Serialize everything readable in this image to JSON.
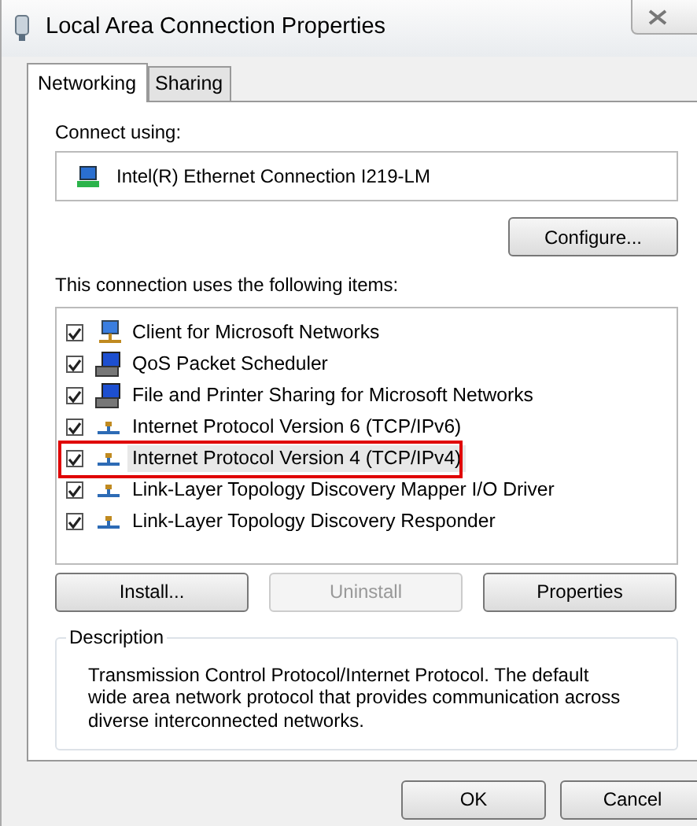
{
  "window": {
    "title": "Local Area Connection Properties"
  },
  "tabs": [
    {
      "label": "Networking",
      "selected": true
    },
    {
      "label": "Sharing",
      "selected": false
    }
  ],
  "connect_using": {
    "label": "Connect using:",
    "adapter": "Intel(R) Ethernet Connection I219-LM",
    "configure_button": "Configure..."
  },
  "items_label": "This connection uses the following items:",
  "items": [
    {
      "kind": "client",
      "label": "Client for Microsoft Networks",
      "checked": true,
      "selected": false,
      "highlighted": false
    },
    {
      "kind": "service",
      "label": "QoS Packet Scheduler",
      "checked": true,
      "selected": false,
      "highlighted": false
    },
    {
      "kind": "service",
      "label": "File and Printer Sharing for Microsoft Networks",
      "checked": true,
      "selected": false,
      "highlighted": false
    },
    {
      "kind": "protocol",
      "label": "Internet Protocol Version 6 (TCP/IPv6)",
      "checked": true,
      "selected": false,
      "highlighted": false
    },
    {
      "kind": "protocol",
      "label": "Internet Protocol Version 4 (TCP/IPv4)",
      "checked": true,
      "selected": true,
      "highlighted": true
    },
    {
      "kind": "protocol",
      "label": "Link-Layer Topology Discovery Mapper I/O Driver",
      "checked": true,
      "selected": false,
      "highlighted": false
    },
    {
      "kind": "protocol",
      "label": "Link-Layer Topology Discovery Responder",
      "checked": true,
      "selected": false,
      "highlighted": false
    }
  ],
  "item_buttons": [
    {
      "label": "Install...",
      "disabled": false
    },
    {
      "label": "Uninstall",
      "disabled": true
    },
    {
      "label": "Properties",
      "disabled": false
    }
  ],
  "description": {
    "title": "Description",
    "text": "Transmission Control Protocol/Internet Protocol. The default wide area network protocol that provides communication across diverse interconnected networks."
  },
  "dialog_buttons": [
    "OK",
    "Cancel"
  ]
}
